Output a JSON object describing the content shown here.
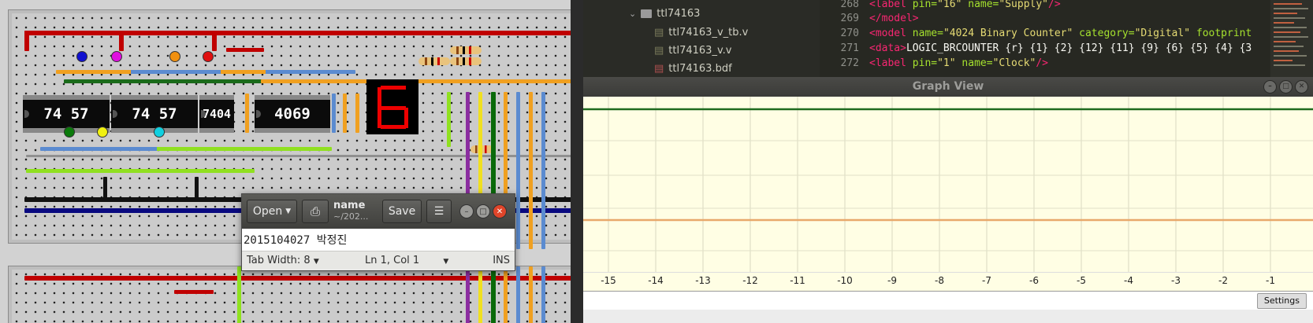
{
  "simulator": {
    "chips": [
      "74 57",
      "74 57",
      "7404",
      "4069"
    ],
    "seven_segment_digit": "6"
  },
  "gedit": {
    "open_label": "Open",
    "title": "name",
    "subtitle": "~/202...",
    "save_label": "Save",
    "content": "2015104027  박정진",
    "tab_width": "Tab Width: 8",
    "cursor_pos": "Ln 1, Col 1",
    "mode": "INS"
  },
  "file_tree": {
    "folder": "ttl74163",
    "files": [
      "ttl74163_v_tb.v",
      "ttl74163_v.v",
      "ttl74163.bdf"
    ]
  },
  "editor": {
    "lines": [
      {
        "num": "268",
        "tag_open": "<label ",
        "a1": "pin=",
        "v1": "\"16\"",
        "a2": " name=",
        "v2": "\"Supply\"",
        "close": "/>"
      },
      {
        "num": "269",
        "text": "</model>"
      },
      {
        "num": "270",
        "tag_open": "<model ",
        "a1": "name=",
        "v1": "\"4024 Binary Counter\"",
        "a2": " category=",
        "v2": "\"Digital\"",
        "close": " footprint"
      },
      {
        "num": "271",
        "tag_open": "<data>",
        "text": "LOGIC_BRCOUNTER {r} {1} {2} {12} {11} {9} {6} {5} {4} {3"
      },
      {
        "num": "272",
        "tag_open": "<label ",
        "a1": "pin=",
        "v1": "\"1\"",
        "a2": " name=",
        "v2": "\"Clock\"",
        "close": "/>"
      }
    ]
  },
  "graph": {
    "title": "Graph View",
    "ticks": [
      "-15",
      "-14",
      "-13",
      "-12",
      "-11",
      "-10",
      "-9",
      "-8",
      "-7",
      "-6",
      "-5",
      "-4",
      "-3",
      "-2",
      "-1"
    ],
    "settings_label": "Settings",
    "colors": {
      "trace_high": "#1f6b1f",
      "trace_low": "#e8a86a",
      "background": "#fffee4"
    }
  }
}
